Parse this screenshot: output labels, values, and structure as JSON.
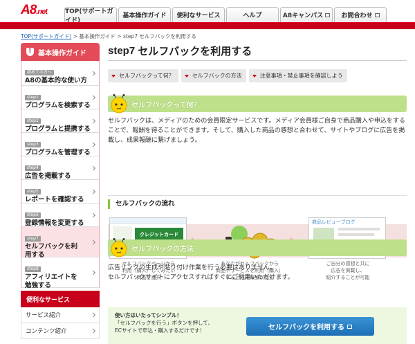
{
  "header": {
    "logo_main": "A8",
    "logo_sub": ".net",
    "nav": [
      {
        "label": "TOP(サポートガイド)",
        "external": false
      },
      {
        "label": "基本操作ガイド",
        "external": false
      },
      {
        "label": "便利なサービス",
        "external": false
      },
      {
        "label": "ヘルプ",
        "external": false
      },
      {
        "label": "A8キャンパス",
        "external": true
      },
      {
        "label": "お問合わせ",
        "external": true
      }
    ]
  },
  "breadcrumb": {
    "home": "TOP(サポートガイド)",
    "sep1": " > ",
    "guide": "基本操作ガイド",
    "sep2": " > ",
    "current": "step7 セルフバックを利用する"
  },
  "sidebar": {
    "title": "基本操作ガイド",
    "items": [
      {
        "tag": "初めての方へ",
        "label": "A8の基本的な使い方"
      },
      {
        "tag": "step1",
        "label": "プログラムを検索する"
      },
      {
        "tag": "step2",
        "label": "プログラムと提携する"
      },
      {
        "tag": "step3",
        "label": "プログラムを管理する"
      },
      {
        "tag": "step4",
        "label": "広告を掲載する"
      },
      {
        "tag": "step5",
        "label": "レポートを確認する"
      },
      {
        "tag": "step6",
        "label": "登録情報を変更する"
      },
      {
        "tag": "step7",
        "label": "セルフバックを利用する"
      },
      {
        "tag": "step8",
        "label": "アフィリエイトを勉強する"
      }
    ],
    "services_title": "便利なサービス",
    "services": [
      "サービス紹介",
      "コンテンツ紹介"
    ]
  },
  "main": {
    "title_step": "step7",
    "title": "セルフバックを利用する",
    "anchors": [
      "セルフバックって何？",
      "セルフバックの方法",
      "注意事項・禁止事項を確認しよう"
    ],
    "section1_title": "セルフバックって何？",
    "section1_body": "セルフバックは、メディアのための会員限定サービスです。メディア会員様ご自身で商品購入や申込をすることで、報酬を得ることができます。そして、購入した商品の感想と合わせて、サイトやブログに広告を掲載し、成果報酬に繋げましょう。",
    "flow_title": "セルフバックの流れ",
    "flow_captions": [
      "セルフバックページから\n利用（購入）してみたい\n商品を選択",
      "あなたがセルフバックから\n商品やサービスを利用（購入）\nすると成果報酬が発生",
      "ご自分の感想と共に\n広告を掲載し、\n紹介することが可能"
    ],
    "flow_card_label": "クレジットカード",
    "flow_review_label": "商品レビューブログ",
    "section2_title": "セルフバックの方法",
    "section2_body": "広告リンクの生成や貼り付け作業を行う必要はありません。\nセルフバックサイトにアクセスすればすぐにご利用いただけます。",
    "cta_text_1": "使い方はいたってシンプル！",
    "cta_text_2": "「セルフバックを行う」ボタンを押して、",
    "cta_text_3": "ECサイトで申込・購入するだけです！",
    "cta_button": "セルフバックを利用する"
  },
  "colors": {
    "brand_red": "#c8001b",
    "sidebar_head": "#e24b57",
    "section_green": "#bfe08a",
    "cta_blue": "#1d6fb6"
  }
}
